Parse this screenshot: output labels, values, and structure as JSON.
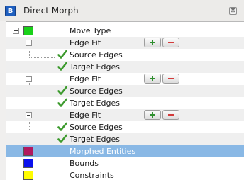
{
  "window": {
    "title": "Direct Morph",
    "app_icon": "direct-morph-app-icon",
    "app_icon_glyph": "B",
    "close_icon": "close-icon",
    "close_glyph": "⊠"
  },
  "colors": {
    "move_type": "#19d119",
    "morphed_entities": "#b1195f",
    "bounds": "#0a11ee",
    "constraints": "#fffc00",
    "check": "#3c9a2d",
    "selection": "#89b8e5"
  },
  "tree": {
    "move_type": {
      "label": "Move Type",
      "swatch": "green"
    },
    "groups": [
      {
        "label": "Edge Fit",
        "add_icon": "plus-icon",
        "remove_icon": "minus-icon",
        "children": [
          {
            "label": "Source Edges",
            "icon": "check-icon"
          },
          {
            "label": "Target Edges",
            "icon": "check-icon"
          }
        ]
      },
      {
        "label": "Edge Fit",
        "add_icon": "plus-icon",
        "remove_icon": "minus-icon",
        "children": [
          {
            "label": "Source Edges",
            "icon": "check-icon"
          },
          {
            "label": "Target Edges",
            "icon": "check-icon"
          }
        ]
      },
      {
        "label": "Edge Fit",
        "add_icon": "plus-icon",
        "remove_icon": "minus-icon",
        "children": [
          {
            "label": "Source Edges",
            "icon": "check-icon"
          },
          {
            "label": "Target Edges",
            "icon": "check-icon"
          }
        ]
      }
    ],
    "morphed_entities": {
      "label": "Morphed Entities",
      "swatch": "magenta",
      "selected": true
    },
    "bounds": {
      "label": "Bounds",
      "swatch": "blue"
    },
    "constraints": {
      "label": "Constraints",
      "swatch": "yellow"
    }
  }
}
